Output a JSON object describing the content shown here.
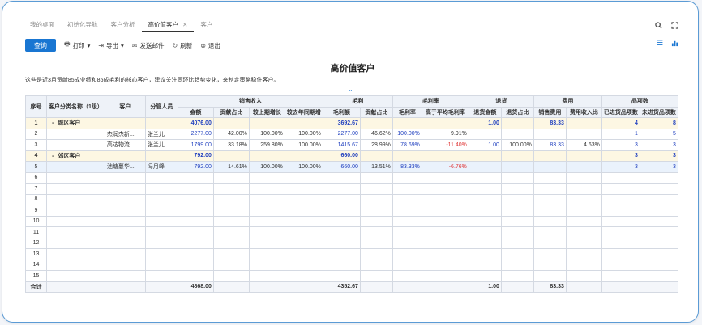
{
  "tabs": [
    {
      "label": "我的桌面",
      "active": false
    },
    {
      "label": "初始化导航",
      "active": false
    },
    {
      "label": "客户分析",
      "active": false
    },
    {
      "label": "高价值客户",
      "active": true
    },
    {
      "label": "客户",
      "active": false
    }
  ],
  "toolbar": {
    "query": "查询",
    "print": "打印",
    "export": "导出",
    "send_mail": "发送邮件",
    "refresh": "刷新",
    "exit": "退出"
  },
  "report": {
    "title": "高价值客户",
    "description": "这些是近3月贡献85成业绩和85成毛利的核心客户，建议关注同环比趋势变化，来制定策略稳住客户。"
  },
  "table": {
    "group_headers": [
      "序号",
      "客户分类名称（1级）",
      "客户",
      "分管人员",
      "销售收入",
      "毛利",
      "毛利率",
      "退货",
      "费用",
      "品项数"
    ],
    "sub_headers": [
      "金额",
      "贡献占比",
      "较上期增长",
      "较去年同期增",
      "毛利额",
      "贡献占比",
      "毛利率",
      "高于平均毛利率",
      "退货金额",
      "退货占比",
      "销售费用",
      "费用收入比",
      "已进货品项数",
      "未进货品项数"
    ],
    "rows": [
      {
        "no": "1",
        "cat": "城区客户",
        "cust": "",
        "mgr": "",
        "amt": "4076.00",
        "pct": "",
        "up": "",
        "yoy": "",
        "gp": "3692.67",
        "gpp": "",
        "gm": "",
        "gmd": "",
        "ret": "1.00",
        "retp": "",
        "fee": "83.33",
        "feep": "",
        "in": "4",
        "out": "8",
        "type": "grp"
      },
      {
        "no": "2",
        "cat": "",
        "cust": "杰润杰新...",
        "mgr": "张兰儿",
        "amt": "2277.00",
        "pct": "42.00%",
        "up": "100.00%",
        "yoy": "100.00%",
        "gp": "2277.00",
        "gpp": "46.62%",
        "gm": "100.00%",
        "gmd": "9.91%",
        "ret": "",
        "retp": "",
        "fee": "",
        "feep": "",
        "in": "1",
        "out": "5",
        "type": "row"
      },
      {
        "no": "3",
        "cat": "",
        "cust": "高达物流",
        "mgr": "张兰儿",
        "amt": "1799.00",
        "pct": "33.18%",
        "up": "259.80%",
        "yoy": "100.00%",
        "gp": "1415.67",
        "gpp": "28.99%",
        "gm": "78.69%",
        "gmd": "-11.40%",
        "ret": "1.00",
        "retp": "100.00%",
        "fee": "83.33",
        "feep": "4.63%",
        "in": "3",
        "out": "3",
        "type": "row"
      },
      {
        "no": "4",
        "cat": "郊区客户",
        "cust": "",
        "mgr": "",
        "amt": "792.00",
        "pct": "",
        "up": "",
        "yoy": "",
        "gp": "660.00",
        "gpp": "",
        "gm": "",
        "gmd": "",
        "ret": "",
        "retp": "",
        "fee": "",
        "feep": "",
        "in": "3",
        "out": "3",
        "type": "grp"
      },
      {
        "no": "5",
        "cat": "",
        "cust": "池塘蔓华...",
        "mgr": "冯月峰",
        "amt": "792.00",
        "pct": "14.61%",
        "up": "100.00%",
        "yoy": "100.00%",
        "gp": "660.00",
        "gpp": "13.51%",
        "gm": "83.33%",
        "gmd": "-6.76%",
        "ret": "",
        "retp": "",
        "fee": "",
        "feep": "",
        "in": "3",
        "out": "3",
        "type": "sel"
      },
      {
        "no": "6",
        "type": "empty"
      },
      {
        "no": "7",
        "type": "empty"
      },
      {
        "no": "8",
        "type": "empty"
      },
      {
        "no": "9",
        "type": "empty"
      },
      {
        "no": "10",
        "type": "empty"
      },
      {
        "no": "11",
        "type": "empty"
      },
      {
        "no": "12",
        "type": "empty"
      },
      {
        "no": "13",
        "type": "empty"
      },
      {
        "no": "14",
        "type": "empty"
      },
      {
        "no": "15",
        "type": "empty"
      }
    ],
    "footer": {
      "label": "合计",
      "amt": "4868.00",
      "gp": "4352.67",
      "ret": "1.00",
      "fee": "83.33"
    }
  },
  "colors": {
    "accent": "#1976d2",
    "negative": "#e03a3a",
    "link": "#1f3fbf",
    "group_row": "#fdf7e3"
  }
}
